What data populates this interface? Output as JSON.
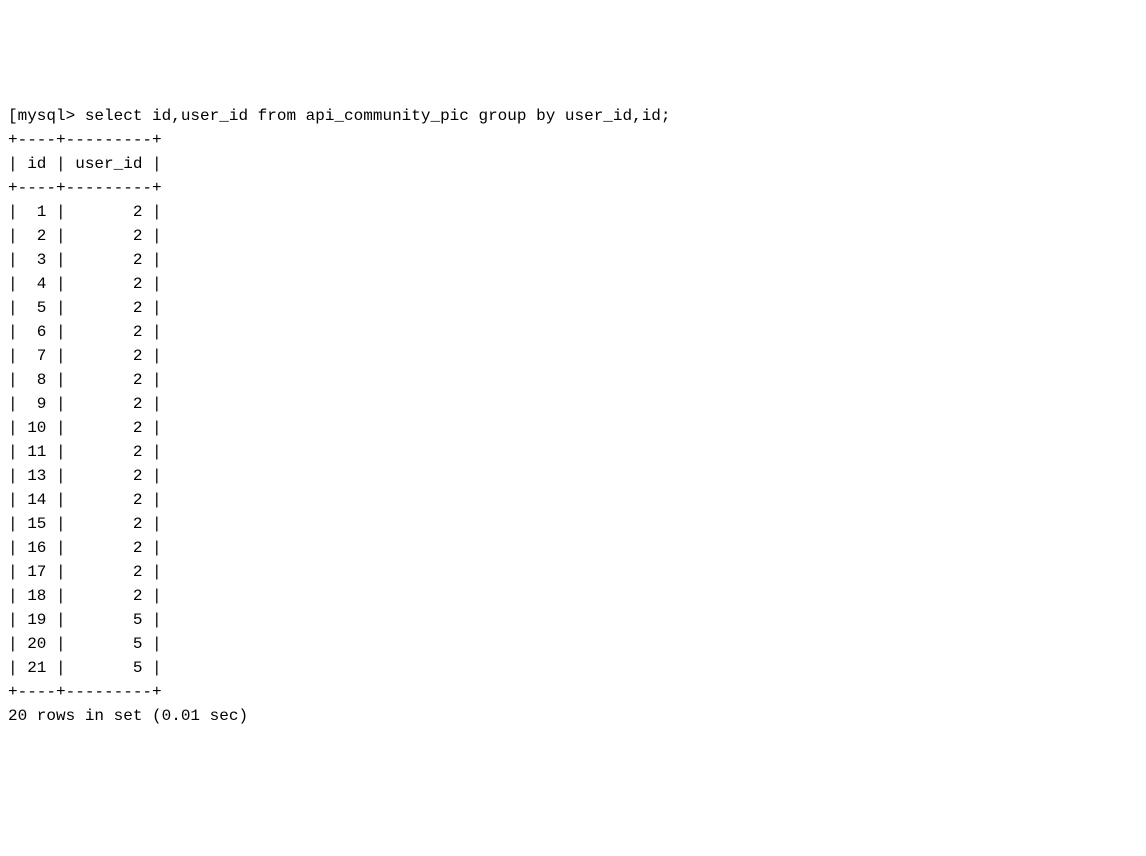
{
  "prompt_prefix": "[mysql> ",
  "query": "select id,user_id from api_community_pic group by user_id,id;",
  "table": {
    "border_top": "+----+---------+",
    "header_line": "| id | user_id |",
    "border_mid": "+----+---------+",
    "columns": [
      "id",
      "user_id"
    ],
    "rows": [
      {
        "id": 1,
        "user_id": 2
      },
      {
        "id": 2,
        "user_id": 2
      },
      {
        "id": 3,
        "user_id": 2
      },
      {
        "id": 4,
        "user_id": 2
      },
      {
        "id": 5,
        "user_id": 2
      },
      {
        "id": 6,
        "user_id": 2
      },
      {
        "id": 7,
        "user_id": 2
      },
      {
        "id": 8,
        "user_id": 2
      },
      {
        "id": 9,
        "user_id": 2
      },
      {
        "id": 10,
        "user_id": 2
      },
      {
        "id": 11,
        "user_id": 2
      },
      {
        "id": 13,
        "user_id": 2
      },
      {
        "id": 14,
        "user_id": 2
      },
      {
        "id": 15,
        "user_id": 2
      },
      {
        "id": 16,
        "user_id": 2
      },
      {
        "id": 17,
        "user_id": 2
      },
      {
        "id": 18,
        "user_id": 2
      },
      {
        "id": 19,
        "user_id": 5
      },
      {
        "id": 20,
        "user_id": 5
      },
      {
        "id": 21,
        "user_id": 5
      }
    ],
    "border_bottom": "+----+---------+"
  },
  "footer": "20 rows in set (0.01 sec)"
}
